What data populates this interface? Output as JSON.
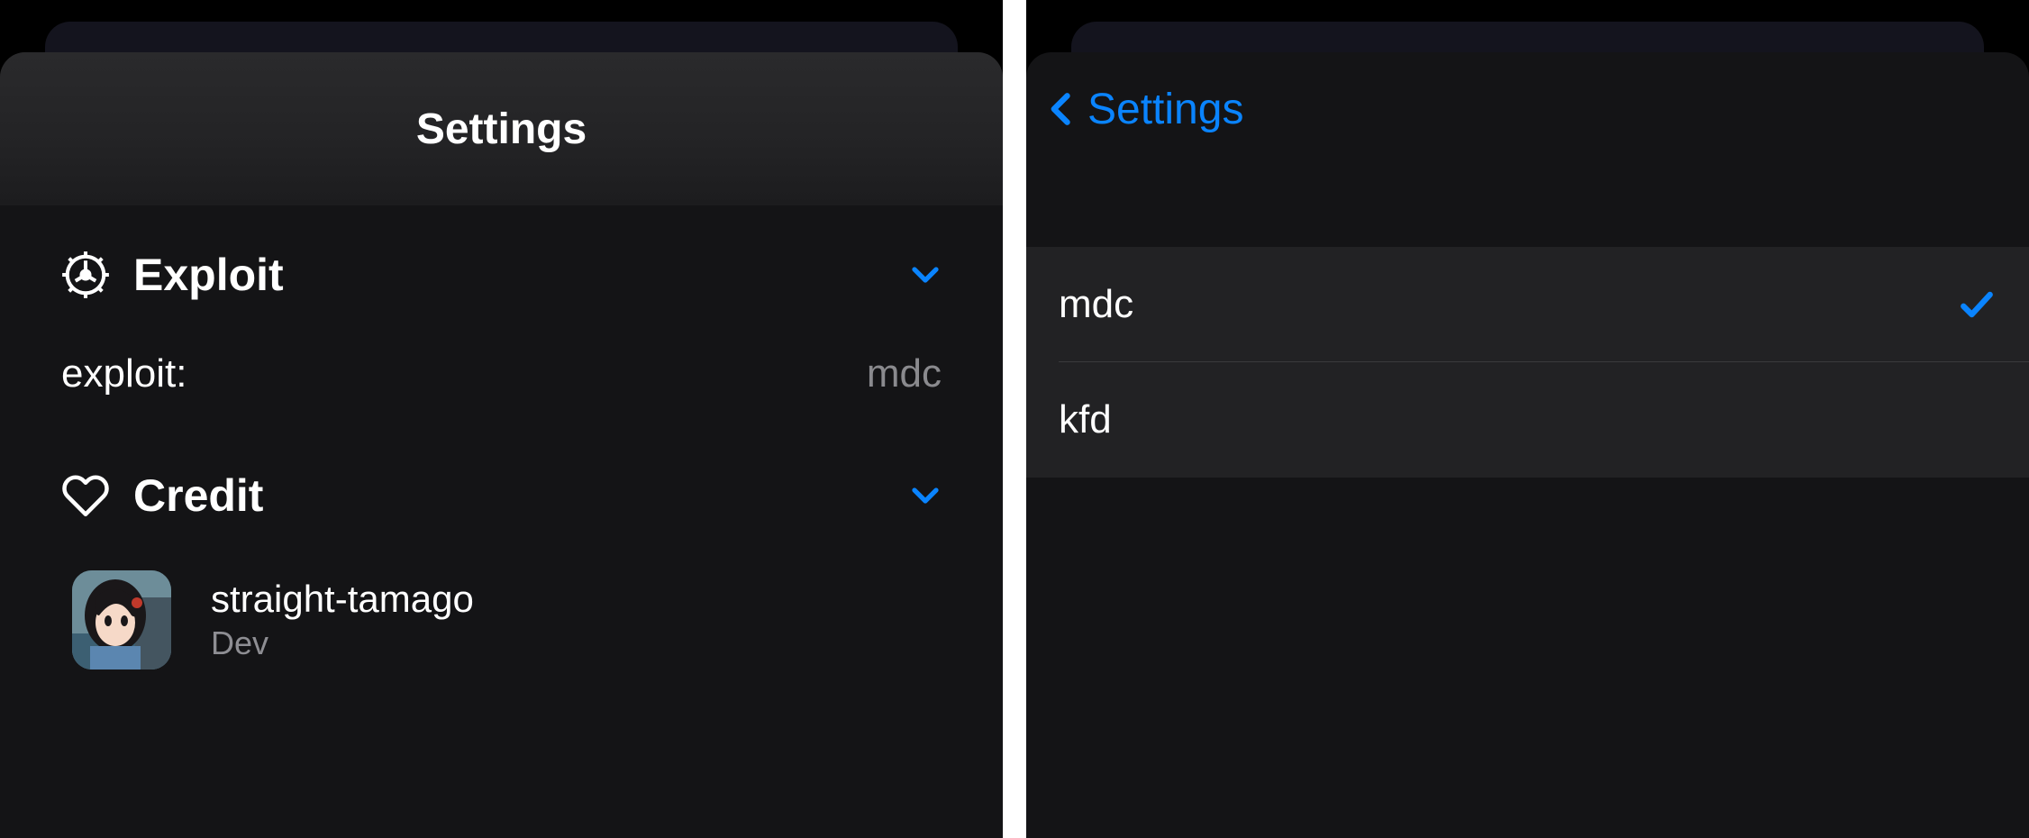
{
  "left": {
    "title": "Settings",
    "sections": {
      "exploit": {
        "title": "Exploit",
        "label": "exploit:",
        "value": "mdc"
      },
      "credit": {
        "title": "Credit",
        "items": [
          {
            "name": "straight-tamago",
            "role": "Dev"
          }
        ]
      }
    }
  },
  "right": {
    "back_label": "Settings",
    "options": [
      {
        "label": "mdc",
        "selected": true
      },
      {
        "label": "kfd",
        "selected": false
      }
    ]
  },
  "colors": {
    "accent": "#0a84ff",
    "background": "#141416",
    "groupedRow": "#222224",
    "secondaryText": "#8e8e93"
  }
}
